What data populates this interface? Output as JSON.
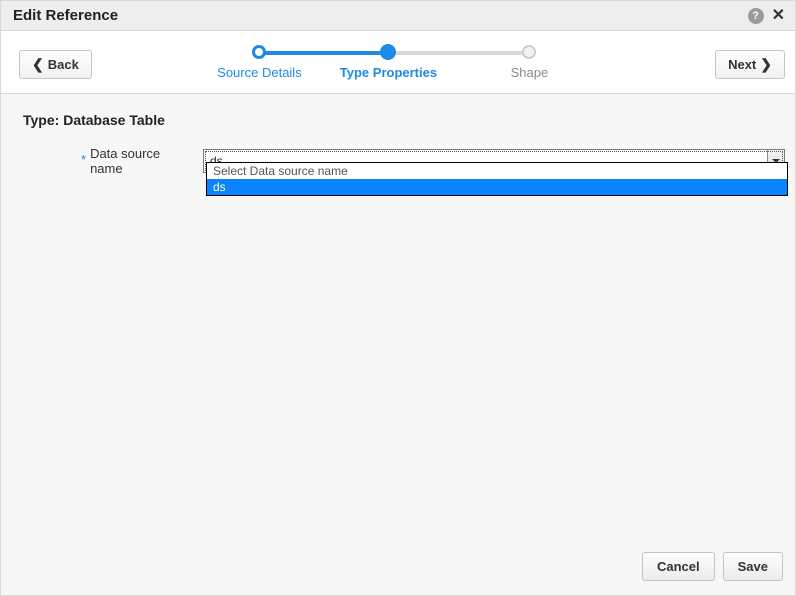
{
  "header": {
    "title": "Edit Reference"
  },
  "nav": {
    "back_label": "Back",
    "next_label": "Next",
    "steps": {
      "s1": "Source Details",
      "s2": "Type Properties",
      "s3": "Shape"
    }
  },
  "body": {
    "type_label": "Type:",
    "type_value": "Database Table",
    "required_mark": "*",
    "field_label": "Data source name",
    "combo_value": "ds",
    "dropdown_prompt": "Select Data source name",
    "dropdown_option_ds": "ds"
  },
  "footer": {
    "cancel": "Cancel",
    "save": "Save"
  }
}
